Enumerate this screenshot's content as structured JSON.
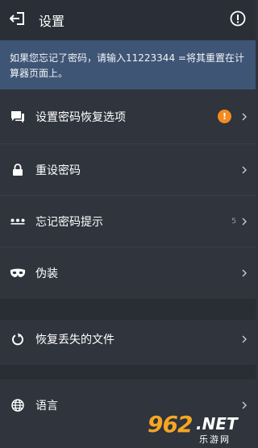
{
  "header": {
    "title": "设置",
    "back_icon": "exit-arrow-icon",
    "info_icon": "exclamation-circle-icon"
  },
  "notice": {
    "text": "如果您忘记了密码，请输入11223344 =将其重置在计算器页面上。"
  },
  "section1": [
    {
      "label": "设置密码恢复选项",
      "icon": "chat-bubble-icon",
      "badge": "!"
    },
    {
      "label": "重设密码",
      "icon": "lock-icon"
    },
    {
      "label": "忘记密码提示",
      "icon": "dots-icon",
      "count": "5"
    },
    {
      "label": "伪装",
      "icon": "mask-icon"
    }
  ],
  "section2": [
    {
      "label": "恢复丢失的文件",
      "icon": "restore-icon"
    }
  ],
  "section3": [
    {
      "label": "语言",
      "icon": "globe-icon"
    }
  ],
  "watermark": {
    "number": "962",
    "domain": ".NET",
    "site": "乐游网"
  },
  "colors": {
    "background": "#2f343d",
    "header": "#2a2f37",
    "notice": "#3f5575",
    "badge": "#f38b1f",
    "watermark": "#f5a623"
  }
}
